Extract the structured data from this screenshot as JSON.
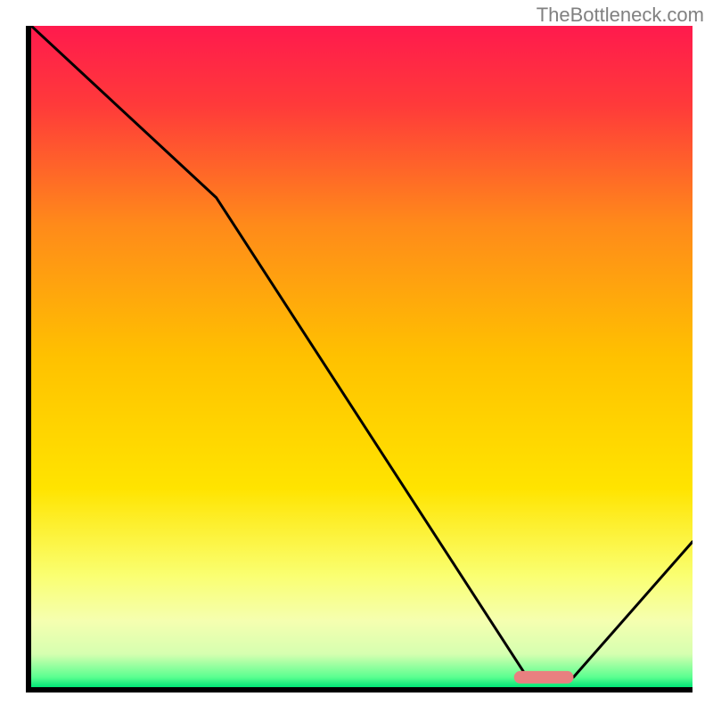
{
  "watermark": "TheBottleneck.com",
  "colors": {
    "axis": "#000000",
    "watermark": "#808080",
    "curve": "#000000",
    "marker_fill": "#e88080",
    "gradient_stops": [
      {
        "offset": 0.0,
        "color": "#ff1a4d"
      },
      {
        "offset": 0.12,
        "color": "#ff3a3a"
      },
      {
        "offset": 0.3,
        "color": "#ff8a1a"
      },
      {
        "offset": 0.5,
        "color": "#ffc100"
      },
      {
        "offset": 0.7,
        "color": "#ffe400"
      },
      {
        "offset": 0.83,
        "color": "#faff70"
      },
      {
        "offset": 0.9,
        "color": "#f5ffb0"
      },
      {
        "offset": 0.95,
        "color": "#d6ffb0"
      },
      {
        "offset": 0.985,
        "color": "#5aff90"
      },
      {
        "offset": 1.0,
        "color": "#00e676"
      }
    ]
  },
  "chart_data": {
    "type": "line",
    "title": "",
    "xlabel": "",
    "ylabel": "",
    "xlim": [
      0,
      100
    ],
    "ylim": [
      0,
      100
    ],
    "series": [
      {
        "name": "bottleneck-curve",
        "x": [
          0,
          28,
          75,
          82,
          100
        ],
        "y": [
          100,
          74,
          1.5,
          1.5,
          22
        ]
      }
    ],
    "marker": {
      "name": "optimal-range",
      "x_start": 73,
      "x_end": 82,
      "y": 1.5
    }
  }
}
